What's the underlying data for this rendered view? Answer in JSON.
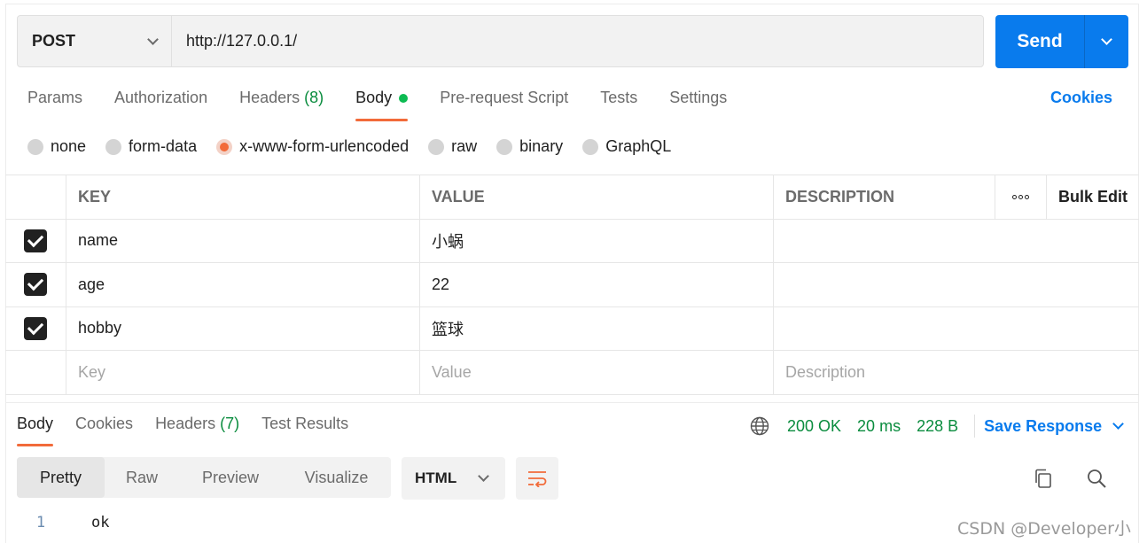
{
  "request": {
    "method": "POST",
    "url": "http://127.0.0.1/",
    "send_label": "Send"
  },
  "request_tabs": {
    "params": "Params",
    "authorization": "Authorization",
    "headers": "Headers",
    "headers_count": "(8)",
    "body": "Body",
    "pre_request": "Pre-request Script",
    "tests": "Tests",
    "settings": "Settings",
    "cookies": "Cookies"
  },
  "body_types": [
    "none",
    "form-data",
    "x-www-form-urlencoded",
    "raw",
    "binary",
    "GraphQL"
  ],
  "selected_body_type": "x-www-form-urlencoded",
  "table": {
    "headers": {
      "key": "KEY",
      "value": "VALUE",
      "description": "DESCRIPTION",
      "bulk_edit": "Bulk Edit"
    },
    "rows": [
      {
        "key": "name",
        "value": "小蜗",
        "checked": true
      },
      {
        "key": "age",
        "value": "22",
        "checked": true
      },
      {
        "key": "hobby",
        "value": "篮球",
        "checked": true
      }
    ],
    "placeholders": {
      "key": "Key",
      "value": "Value",
      "description": "Description"
    }
  },
  "response_tabs": {
    "body": "Body",
    "cookies": "Cookies",
    "headers": "Headers",
    "headers_count": "(7)",
    "test_results": "Test Results"
  },
  "response_meta": {
    "status": "200 OK",
    "time": "20 ms",
    "size": "228 B",
    "save_response": "Save Response"
  },
  "view_modes": [
    "Pretty",
    "Raw",
    "Preview",
    "Visualize"
  ],
  "selected_view_mode": "Pretty",
  "format": "HTML",
  "code_lines": [
    {
      "number": "1",
      "text": "ok"
    }
  ],
  "watermark": "CSDN @Developer小蜗",
  "colors": {
    "accent_orange": "#f26b3a",
    "send_blue": "#097bed",
    "success_green": "#0a8c3e"
  }
}
